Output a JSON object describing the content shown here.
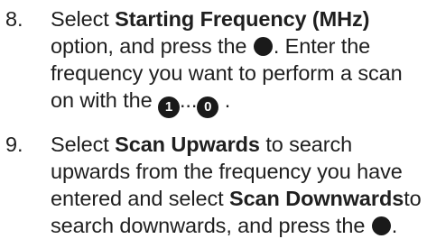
{
  "steps": [
    {
      "number": "8.",
      "t1": "Select ",
      "b1": "Starting Frequency (MHz)",
      "t2": " option, and press the ",
      "t3": ". Enter the frequency you want to perform a scan on with the ",
      "key_first": "1",
      "ellipsis": "...",
      "key_last": "0",
      "t4": " ."
    },
    {
      "number": "9.",
      "t1": "Select ",
      "b1": "Scan Upwards",
      "t2": " to search upwards from the frequency you have entered and select ",
      "b2": "Scan Downwards",
      "t3": "to search downwards, and press the ",
      "t4": "."
    }
  ],
  "icons": {
    "ok_button": "filled-circle-icon",
    "number_keys": "filled-circle-number-icon"
  }
}
